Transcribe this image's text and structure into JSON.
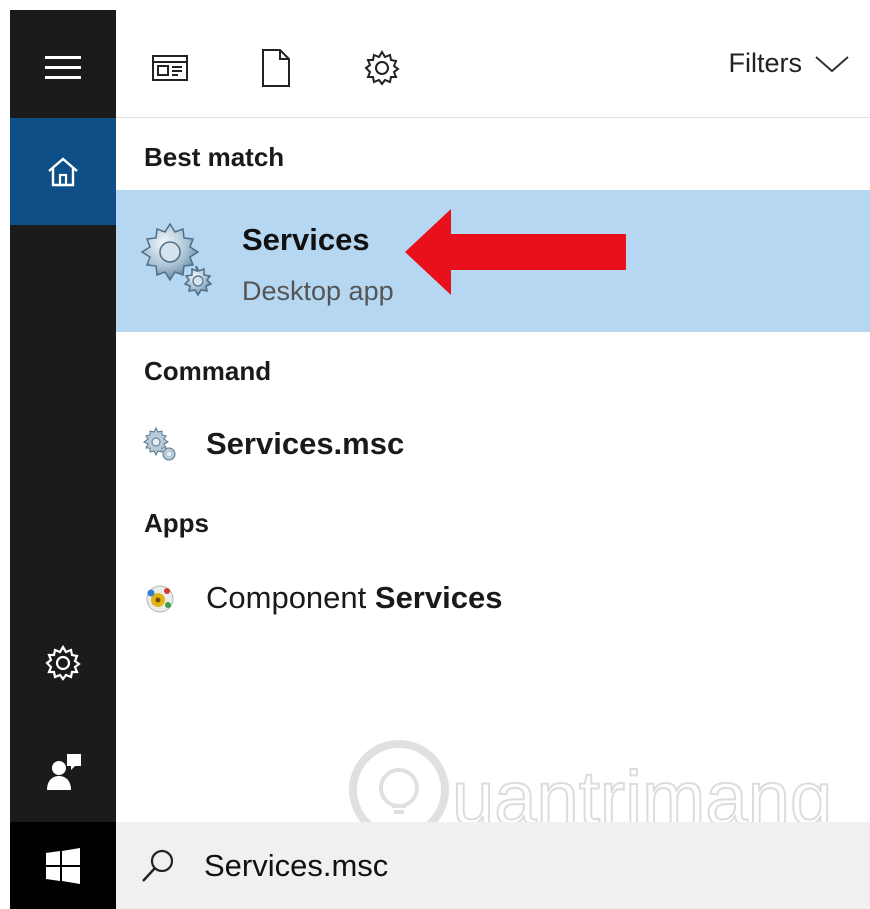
{
  "toolbar": {
    "filters_label": "Filters",
    "icons": [
      "apps-icon",
      "documents-icon",
      "settings-icon",
      "chevron-down-icon"
    ]
  },
  "rail": {
    "icons": [
      "hamburger-menu-icon",
      "home-icon",
      "settings-icon",
      "feedback-icon",
      "windows-logo-icon"
    ]
  },
  "sections": {
    "best_match": "Best match",
    "command": "Command",
    "apps": "Apps"
  },
  "best_match": {
    "title": "Services",
    "subtitle": "Desktop app",
    "icon": "services-gears-icon",
    "highlight_color": "#b5d7f1"
  },
  "command_results": [
    {
      "label": "Services.msc",
      "icon": "services-gears-icon"
    }
  ],
  "app_results": [
    {
      "label_prefix": "Component ",
      "label_match": "Services",
      "icon": "component-services-icon"
    }
  ],
  "search": {
    "value": "Services.msc",
    "icon": "search-icon"
  },
  "watermark": {
    "text": "uantrimang"
  },
  "colors": {
    "rail_bg": "#1b1b1b",
    "rail_active": "#0e4f87",
    "arrow": "#e8101a",
    "search_bg": "#f0f0f0"
  }
}
